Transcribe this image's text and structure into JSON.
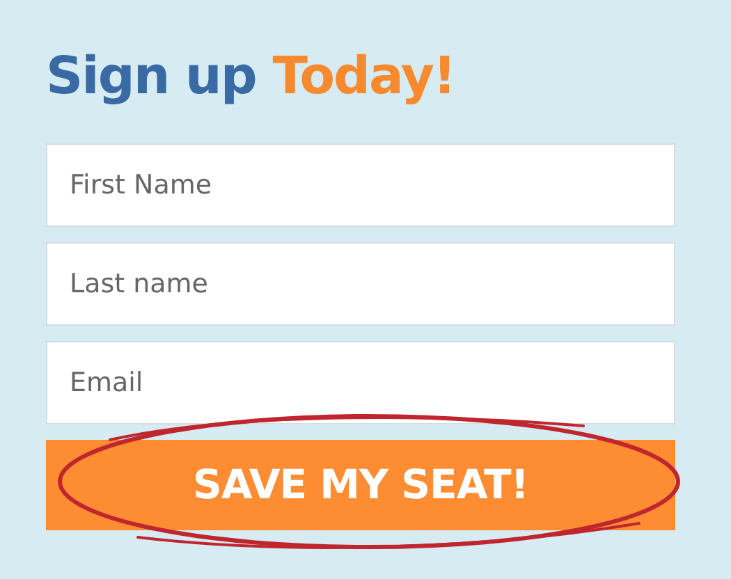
{
  "title": [
    {
      "text": "Sign up",
      "color": "#3a6aa3"
    },
    {
      "text": "Today!",
      "color": "#f7892e"
    }
  ],
  "fields": [
    {
      "placeholder": "First Name"
    },
    {
      "placeholder": "Last name"
    },
    {
      "placeholder": "Email"
    }
  ],
  "submit_button": {
    "label": "SAVE MY SEAT!"
  }
}
